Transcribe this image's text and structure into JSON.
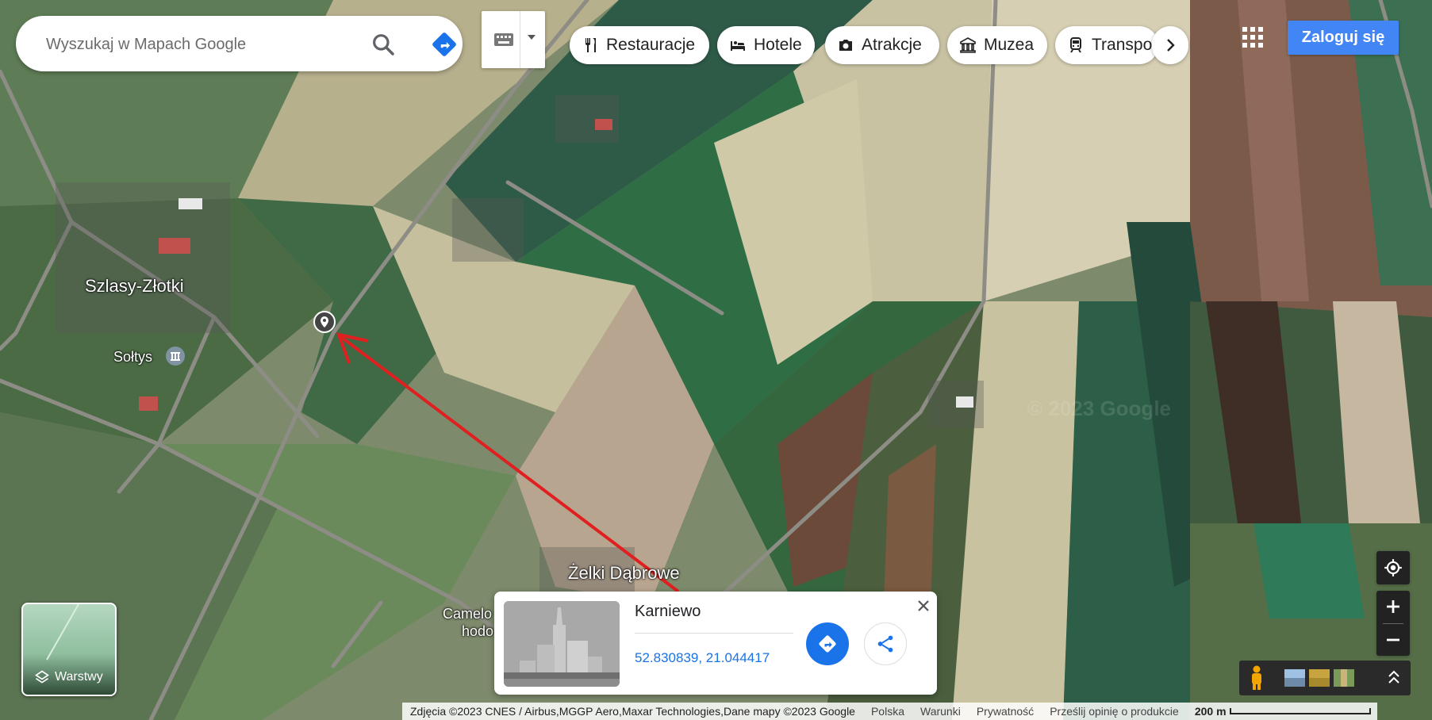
{
  "search": {
    "placeholder": "Wyszukaj w Mapach Google"
  },
  "categories": [
    {
      "label": "Restauracje",
      "icon": "fork-knife-icon"
    },
    {
      "label": "Hotele",
      "icon": "bed-icon"
    },
    {
      "label": "Atrakcje",
      "icon": "camera-icon"
    },
    {
      "label": "Muzea",
      "icon": "museum-icon"
    },
    {
      "label": "Transpo",
      "icon": "train-icon"
    }
  ],
  "header": {
    "signin_label": "Zaloguj się"
  },
  "map_labels": {
    "village1": "Szlasy-Złotki",
    "poi1": "Sołtys",
    "village2": "Żelki Dąbrowe",
    "poi2_line1": "Camelo",
    "poi2_line2": "hodo",
    "watermark": "© 2023 Google"
  },
  "layers": {
    "label": "Warstwy"
  },
  "place_card": {
    "title": "Karniewo",
    "coordinates": "52.830839, 21.044417"
  },
  "footer": {
    "attribution": "Zdjęcia ©2023 CNES / Airbus,MGGP Aero,Maxar Technologies,Dane mapy ©2023 Google",
    "country": "Polska",
    "terms": "Warunki",
    "privacy": "Prywatność",
    "feedback": "Prześlij opinię o produkcie",
    "scale": "200 m"
  },
  "colors": {
    "accent": "#1a73e8",
    "signin": "#4285f4",
    "arrow": "#e02020"
  }
}
